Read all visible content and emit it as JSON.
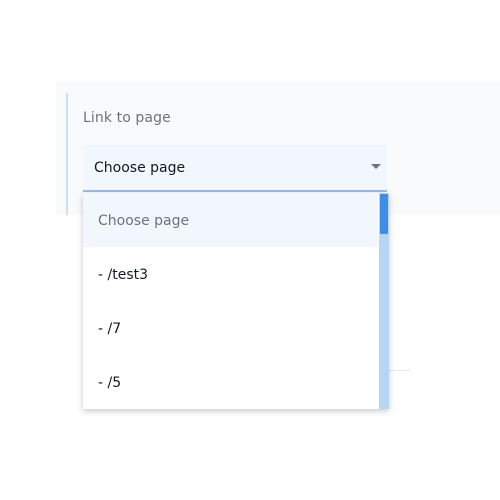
{
  "field": {
    "label": "Link to page",
    "selected_value": "Choose page",
    "caret_icon": "chevron-down-icon"
  },
  "dropdown": {
    "options": [
      {
        "label": "Choose page",
        "is_placeholder": true
      },
      {
        "label": "- /test3"
      },
      {
        "label": "- /7"
      },
      {
        "label": "- /5"
      }
    ],
    "scroll_position": 0
  },
  "colors": {
    "accent": "#8fc0ec",
    "select_bg": "#f1f7fc",
    "scroll_thumb": "#3d8ee6",
    "scroll_track": "#b7d6f4"
  }
}
